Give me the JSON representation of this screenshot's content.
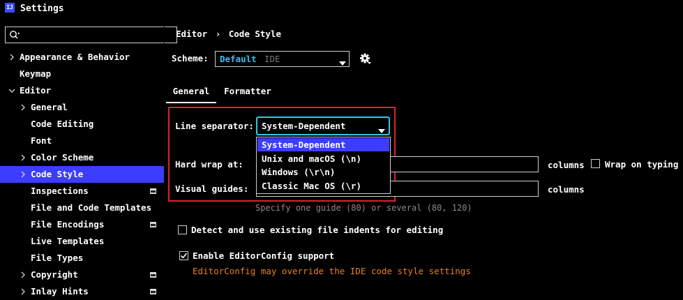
{
  "window": {
    "app_icon": "IJ",
    "title": "Settings"
  },
  "search": {
    "placeholder": "",
    "icon": "search-icon"
  },
  "sidebar": {
    "items": [
      {
        "label": "Appearance & Behavior",
        "level": 0,
        "expander": "collapsed",
        "selected": false,
        "project_icon": false
      },
      {
        "label": "Keymap",
        "level": 0,
        "expander": "none",
        "selected": false,
        "project_icon": false
      },
      {
        "label": "Editor",
        "level": 0,
        "expander": "expanded",
        "selected": false,
        "project_icon": false
      },
      {
        "label": "General",
        "level": 1,
        "expander": "collapsed",
        "selected": false,
        "project_icon": false
      },
      {
        "label": "Code Editing",
        "level": 1,
        "expander": "none",
        "selected": false,
        "project_icon": false
      },
      {
        "label": "Font",
        "level": 1,
        "expander": "none",
        "selected": false,
        "project_icon": false
      },
      {
        "label": "Color Scheme",
        "level": 1,
        "expander": "collapsed",
        "selected": false,
        "project_icon": false
      },
      {
        "label": "Code Style",
        "level": 1,
        "expander": "collapsed",
        "selected": true,
        "project_icon": false
      },
      {
        "label": "Inspections",
        "level": 1,
        "expander": "none",
        "selected": false,
        "project_icon": true
      },
      {
        "label": "File and Code Templates",
        "level": 1,
        "expander": "none",
        "selected": false,
        "project_icon": false
      },
      {
        "label": "File Encodings",
        "level": 1,
        "expander": "none",
        "selected": false,
        "project_icon": true
      },
      {
        "label": "Live Templates",
        "level": 1,
        "expander": "none",
        "selected": false,
        "project_icon": false
      },
      {
        "label": "File Types",
        "level": 1,
        "expander": "none",
        "selected": false,
        "project_icon": false
      },
      {
        "label": "Copyright",
        "level": 1,
        "expander": "collapsed",
        "selected": false,
        "project_icon": true
      },
      {
        "label": "Inlay Hints",
        "level": 1,
        "expander": "collapsed",
        "selected": false,
        "project_icon": true
      }
    ]
  },
  "breadcrumb": {
    "parent": "Editor",
    "separator": "›",
    "current": "Code Style"
  },
  "scheme": {
    "label": "Scheme:",
    "value": "Default",
    "sub": "IDE"
  },
  "tabs": [
    {
      "label": "General",
      "active": true
    },
    {
      "label": "Formatter",
      "active": false
    }
  ],
  "general": {
    "line_separator": {
      "label": "Line separator:",
      "value": "System-Dependent",
      "options": [
        "System-Dependent",
        "Unix and macOS (\\n)",
        "Windows (\\r\\n)",
        "Classic Mac OS (\\r)"
      ],
      "highlighted_index": 0
    },
    "hard_wrap": {
      "label": "Hard wrap at:",
      "value": "",
      "suffix": "columns"
    },
    "wrap_on_typing": {
      "label": "Wrap on typing",
      "checked": false
    },
    "visual_guides": {
      "label": "Visual guides:",
      "value": "",
      "suffix": "columns",
      "hint": "Specify one guide (80) or several (80, 120)"
    },
    "detect_indents": {
      "label": "Detect and use existing file indents for editing",
      "checked": false
    },
    "editorconfig": {
      "label": "Enable EditorConfig support",
      "checked": true,
      "warning": "EditorConfig may override the IDE code style settings"
    }
  },
  "colors": {
    "accent": "#3d3dff",
    "focus": "#2ec8e8",
    "highlight_box": "#e0212b",
    "warning": "#e8821e",
    "scheme_value": "#36c2f0"
  }
}
